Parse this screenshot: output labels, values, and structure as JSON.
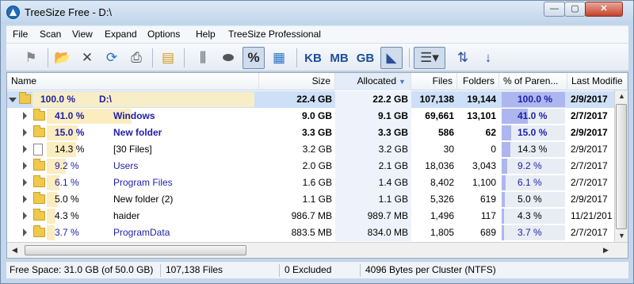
{
  "window": {
    "title": "TreeSize Free - D:\\",
    "min": "—",
    "max": "▢",
    "close": "✕"
  },
  "menu": [
    "File",
    "Scan",
    "View",
    "Expand",
    "Options",
    "Help",
    "TreeSize Professional"
  ],
  "toolbar": {
    "kb": "KB",
    "mb": "MB",
    "gb": "GB",
    "percent": "%"
  },
  "columns": {
    "name": "Name",
    "size": "Size",
    "allocated": "Allocated",
    "files": "Files",
    "folders": "Folders",
    "percent_parent": "% of Paren...",
    "last_modified": "Last Modifie"
  },
  "rows": [
    {
      "pct": "100.0 %",
      "name": "D:\\",
      "size": "22.4 GB",
      "allocated": "22.2 GB",
      "files": "107,138",
      "folders": "19,144",
      "pp": "100.0 %",
      "modified": "2/9/2017",
      "fraction": 1.0
    },
    {
      "pct": "41.0 %",
      "name": "Windows",
      "size": "9.0 GB",
      "allocated": "9.1 GB",
      "files": "69,661",
      "folders": "13,101",
      "pp": "41.0 %",
      "modified": "2/7/2017",
      "fraction": 0.41
    },
    {
      "pct": "15.0 %",
      "name": "New folder",
      "size": "3.3 GB",
      "allocated": "3.3 GB",
      "files": "586",
      "folders": "62",
      "pp": "15.0 %",
      "modified": "2/9/2017",
      "fraction": 0.15
    },
    {
      "pct": "14.3 %",
      "name": "[30 Files]",
      "size": "3.2 GB",
      "allocated": "3.2 GB",
      "files": "30",
      "folders": "0",
      "pp": "14.3 %",
      "modified": "2/9/2017",
      "fraction": 0.143
    },
    {
      "pct": "9.2 %",
      "name": "Users",
      "size": "2.0 GB",
      "allocated": "2.1 GB",
      "files": "18,036",
      "folders": "3,043",
      "pp": "9.2 %",
      "modified": "2/7/2017",
      "fraction": 0.092
    },
    {
      "pct": "6.1 %",
      "name": "Program Files",
      "size": "1.6 GB",
      "allocated": "1.4 GB",
      "files": "8,402",
      "folders": "1,100",
      "pp": "6.1 %",
      "modified": "2/7/2017",
      "fraction": 0.061
    },
    {
      "pct": "5.0 %",
      "name": "New folder (2)",
      "size": "1.1 GB",
      "allocated": "1.1 GB",
      "files": "5,326",
      "folders": "619",
      "pp": "5.0 %",
      "modified": "2/9/2017",
      "fraction": 0.05
    },
    {
      "pct": "4.3 %",
      "name": "haider",
      "size": "986.7 MB",
      "allocated": "989.7 MB",
      "files": "1,496",
      "folders": "117",
      "pp": "4.3 %",
      "modified": "11/21/201",
      "fraction": 0.043
    },
    {
      "pct": "3.7 %",
      "name": "ProgramData",
      "size": "883.5 MB",
      "allocated": "834.0 MB",
      "files": "1,805",
      "folders": "689",
      "pp": "3.7 %",
      "modified": "2/7/2017",
      "fraction": 0.037
    }
  ],
  "status": {
    "free_space": "Free Space: 31.0 GB  (of 50.0 GB)",
    "files": "107,138  Files",
    "excluded": "0 Excluded",
    "cluster": "4096  Bytes per Cluster (NTFS)"
  }
}
